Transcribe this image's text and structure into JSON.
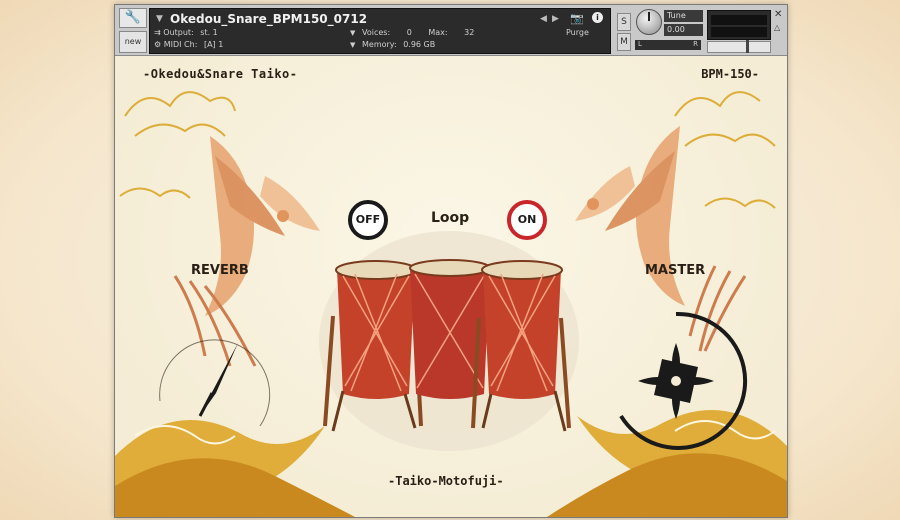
{
  "header": {
    "instrument_name": "Okedou_Snare_BPM150_0712",
    "output_label": "Output:",
    "output_value": "st. 1",
    "midi_label": "MIDI Ch:",
    "midi_value": "[A]  1",
    "voices_label": "Voices:",
    "voices_value": "0",
    "max_label": "Max:",
    "max_value": "32",
    "memory_label": "Memory:",
    "memory_value": "0.96 GB",
    "purge_label": "Purge",
    "tune_label": "Tune",
    "tune_value": "0.00",
    "solo_label": "S",
    "mute_label": "M",
    "pan_l": "L",
    "pan_r": "R",
    "new_label": "new"
  },
  "panel": {
    "title_left": "-Okedou&Snare  Taiko-",
    "title_right": "BPM-150-",
    "loop_label": "Loop",
    "off_label": "OFF",
    "on_label": "ON",
    "reverb_label": "REVERB",
    "master_label": "MASTER",
    "bottom_title": "-Taiko-Motofuji-"
  },
  "colors": {
    "accent_red": "#c8262a",
    "ink": "#1a1a1a",
    "gold": "#d9a21f",
    "panel_bg": "#f4ecd4"
  }
}
